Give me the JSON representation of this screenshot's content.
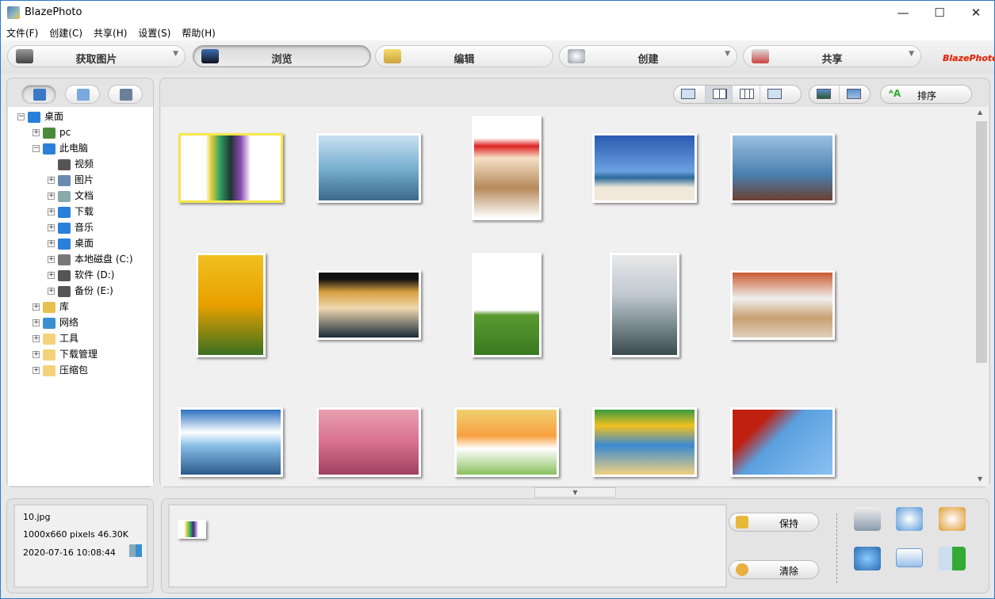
{
  "window": {
    "title": "BlazePhoto"
  },
  "menu": [
    "文件(F)",
    "创建(C)",
    "共享(H)",
    "设置(S)",
    "帮助(H)"
  ],
  "toolbar": {
    "acquire": "获取图片",
    "browse": "浏览",
    "edit": "编辑",
    "create": "创建",
    "share": "共享",
    "logo": "BlazePhoto"
  },
  "tree": [
    {
      "label": "桌面",
      "level": 0,
      "expanded": true
    },
    {
      "label": "pc",
      "level": 1
    },
    {
      "label": "此电脑",
      "level": 1,
      "expanded": true
    },
    {
      "label": "视频",
      "level": 2
    },
    {
      "label": "图片",
      "level": 2
    },
    {
      "label": "文档",
      "level": 2
    },
    {
      "label": "下载",
      "level": 2
    },
    {
      "label": "音乐",
      "level": 2
    },
    {
      "label": "桌面",
      "level": 2
    },
    {
      "label": "本地磁盘 (C:)",
      "level": 2
    },
    {
      "label": "软件 (D:)",
      "level": 2
    },
    {
      "label": "备份 (E:)",
      "level": 2
    },
    {
      "label": "库",
      "level": 1
    },
    {
      "label": "网络",
      "level": 1
    },
    {
      "label": "工具",
      "level": 1
    },
    {
      "label": "下载管理",
      "level": 1
    },
    {
      "label": "压缩包",
      "level": 1
    }
  ],
  "viewbar": {
    "sort": "排序",
    "active_view": "large-thumbnails"
  },
  "thumbnails": [
    {
      "o": "L",
      "selected": true
    },
    {
      "o": "L"
    },
    {
      "o": "P"
    },
    {
      "o": "L"
    },
    {
      "o": "L"
    },
    {
      "o": "P"
    },
    {
      "o": "L"
    },
    {
      "o": "P"
    },
    {
      "o": "P"
    },
    {
      "o": "L"
    },
    {
      "o": "L"
    },
    {
      "o": "L"
    },
    {
      "o": "L"
    },
    {
      "o": "L"
    },
    {
      "o": "L"
    }
  ],
  "info": {
    "filename": "10.jpg",
    "dims": "1000x660 pixels  46.30K",
    "date": "2020-07-16 10:08:44"
  },
  "tray": {
    "keep": "保持",
    "clear": "清除"
  }
}
